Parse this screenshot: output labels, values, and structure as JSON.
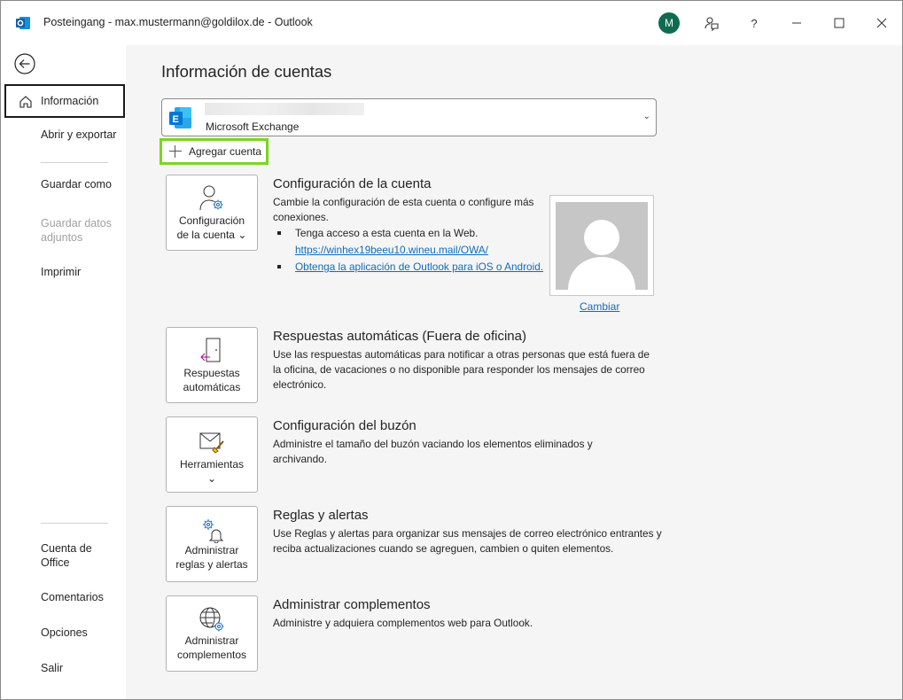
{
  "window": {
    "title": "Posteingang - max.mustermann@goldilox.de  -  Outlook",
    "avatar_initial": "M",
    "help_label": "?"
  },
  "nav": {
    "items": [
      {
        "label": "Información"
      },
      {
        "label": "Abrir y exportar"
      },
      {
        "label": "Guardar como"
      },
      {
        "label": "Guardar datos adjuntos"
      },
      {
        "label": "Imprimir"
      },
      {
        "label": "Cuenta de Office"
      },
      {
        "label": "Comentarios"
      },
      {
        "label": "Opciones"
      },
      {
        "label": "Salir"
      }
    ]
  },
  "main": {
    "title": "Información de cuentas",
    "account": {
      "type": "Microsoft Exchange"
    },
    "add_account_label": "Agregar cuenta",
    "sections": {
      "account_settings": {
        "tile_label_1": "Configuración",
        "tile_label_2": "de la cuenta",
        "title": "Configuración de la cuenta",
        "desc": "Cambie la configuración de esta cuenta o configure más conexiones.",
        "bullet_1": "Tenga acceso a esta cuenta en la Web.",
        "bullet_1_link": "https://winhex19beeu10.wineu.mail/OWA/",
        "bullet_2_link": "Obtenga la aplicación de Outlook para iOS o Android.",
        "change_photo": "Cambiar"
      },
      "auto_replies": {
        "tile_label_1": "Respuestas",
        "tile_label_2": "automáticas",
        "title": "Respuestas automáticas (Fuera de oficina)",
        "desc": "Use las respuestas automáticas para notificar a otras personas que está fuera de la oficina, de vacaciones o no disponible para responder los mensajes de correo electrónico."
      },
      "mailbox": {
        "tile_label": "Herramientas",
        "title": "Configuración del buzón",
        "desc": "Administre el tamaño del buzón vaciando los elementos eliminados y archivando."
      },
      "rules": {
        "tile_label_1": "Administrar",
        "tile_label_2": "reglas y alertas",
        "title": "Reglas y alertas",
        "desc": "Use Reglas y alertas para organizar sus mensajes de correo electrónico entrantes y reciba actualizaciones cuando se agreguen, cambien o quiten elementos."
      },
      "addins": {
        "tile_label_1": "Administrar",
        "tile_label_2": "complementos",
        "title": "Administrar complementos",
        "desc": "Administre y adquiera complementos web para Outlook."
      }
    }
  },
  "colors": {
    "accent": "#0f6cbd",
    "highlight_border": "#7ed321",
    "avatar_bg": "#0e6b4f"
  }
}
